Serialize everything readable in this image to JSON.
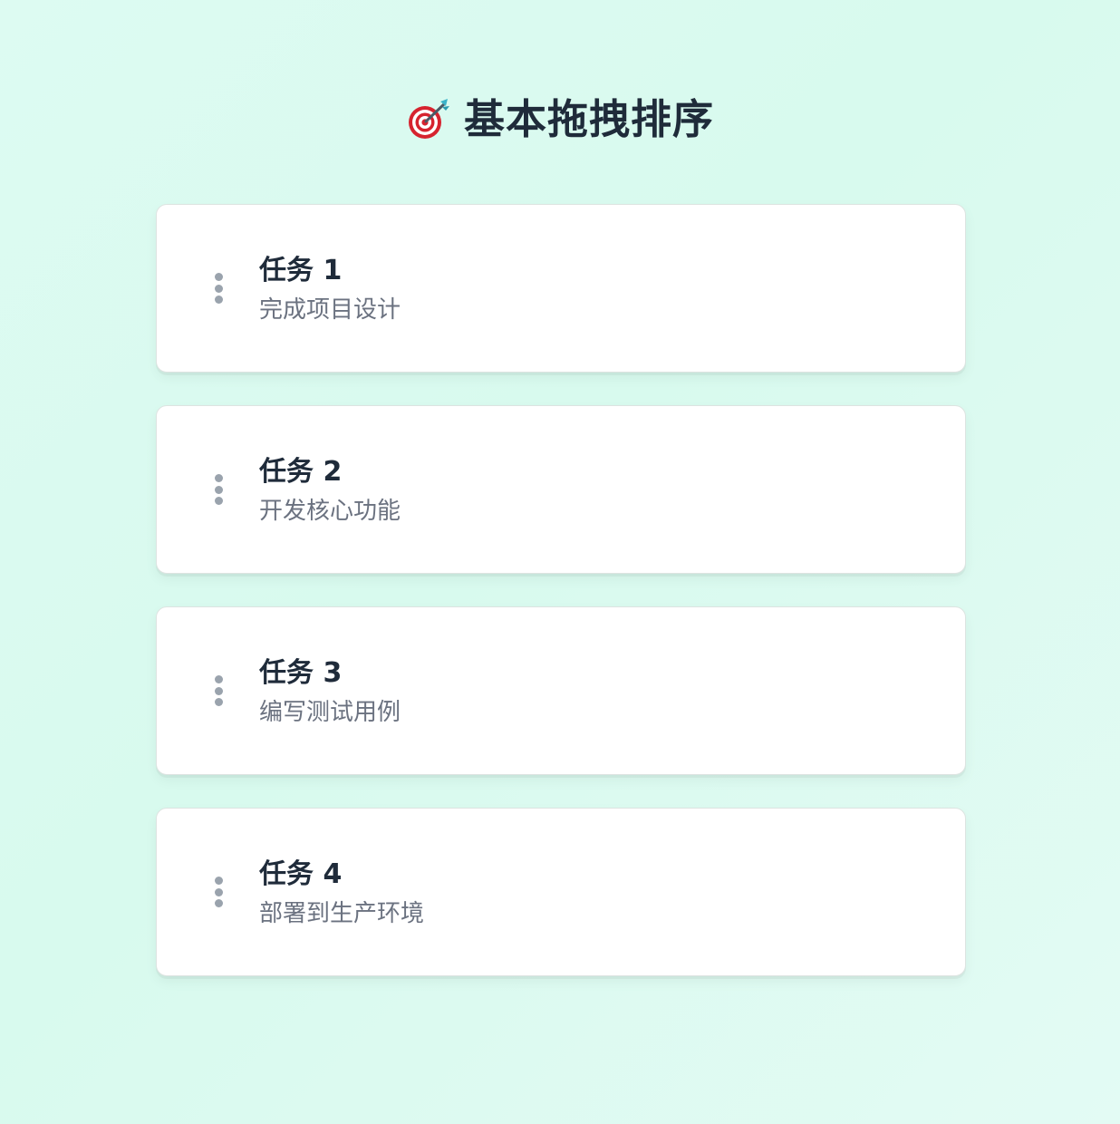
{
  "header": {
    "icon": "target-dart-icon",
    "title": "基本拖拽排序"
  },
  "tasks": [
    {
      "title": "任务 1",
      "description": "完成项目设计"
    },
    {
      "title": "任务 2",
      "description": "开发核心功能"
    },
    {
      "title": "任务 3",
      "description": "编写测试用例"
    },
    {
      "title": "任务 4",
      "description": "部署到生产环境"
    }
  ],
  "colors": {
    "background": "#dcfaf1",
    "title_text": "#1f2b3a",
    "description_text": "#6b7280",
    "handle_dots": "#9aa3ad",
    "card_background": "#ffffff"
  }
}
